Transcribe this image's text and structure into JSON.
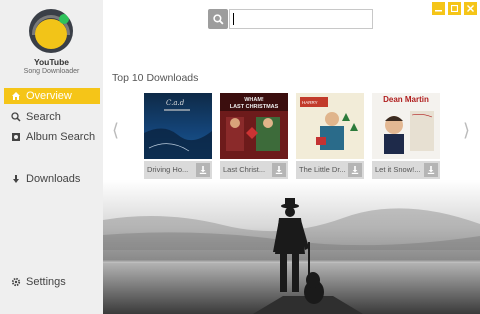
{
  "app": {
    "name": "YouTube",
    "subtitle": "Song Downloader"
  },
  "sidebar": {
    "items": [
      {
        "label": "Overview",
        "icon": "home-icon",
        "active": true
      },
      {
        "label": "Search",
        "icon": "search-icon",
        "active": false
      },
      {
        "label": "Album Search",
        "icon": "album-icon",
        "active": false
      },
      {
        "label": "Downloads",
        "icon": "download-arrow-icon",
        "active": false
      },
      {
        "label": "Settings",
        "icon": "gear-icon",
        "active": false
      }
    ]
  },
  "search": {
    "value": "",
    "placeholder": ""
  },
  "window_controls": [
    "minimize",
    "maximize",
    "close"
  ],
  "main": {
    "section_title": "Top 10 Downloads",
    "cards": [
      {
        "title": "Driving Ho...",
        "cover_text": ""
      },
      {
        "title": "Last Christ...",
        "cover_text": "WHAM! LAST CHRISTMAS"
      },
      {
        "title": "The Little Dr...",
        "cover_text": ""
      },
      {
        "title": "Let it Snow!...",
        "cover_text": "Dean Martin"
      }
    ]
  },
  "colors": {
    "accent": "#f5c518",
    "sidebar_bg": "#efefef",
    "main_bg": "#ffffff"
  }
}
